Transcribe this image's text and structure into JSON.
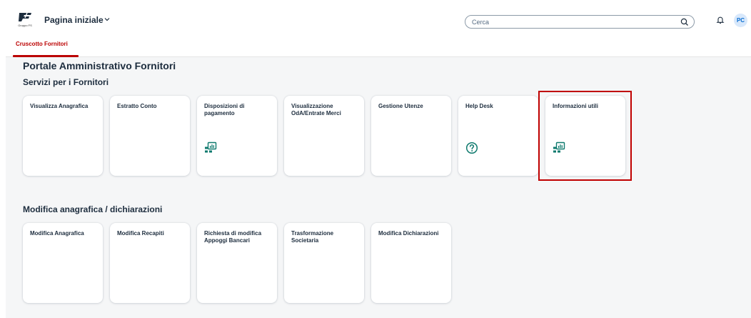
{
  "shell": {
    "logo_caption": "Gruppo FS",
    "app_title": "Pagina iniziale",
    "search_placeholder": "Cerca",
    "avatar_initials": "PC"
  },
  "tabs": [
    {
      "label": "Cruscotto Fornitori",
      "selected": true
    }
  ],
  "page": {
    "title": "Portale Amministrativo Fornitori"
  },
  "sections": [
    {
      "title": "Servizi per i Fornitori",
      "tiles": [
        {
          "label": "Visualizza Anagrafica",
          "icon": ""
        },
        {
          "label": "Estratto Conto",
          "icon": ""
        },
        {
          "label": "Disposizioni di pagamento",
          "icon": "chart-screen-icon"
        },
        {
          "label": "Visualizzazione OdA/Entrate Merci",
          "icon": ""
        },
        {
          "label": "Gestione Utenze",
          "icon": ""
        },
        {
          "label": "Help Desk",
          "icon": "help-circle-icon"
        },
        {
          "label": "Informazioni utili",
          "icon": "chart-screen-icon",
          "highlighted": true
        }
      ]
    },
    {
      "title": "Modifica anagrafica / dichiarazioni",
      "tiles": [
        {
          "label": "Modifica Anagrafica",
          "icon": ""
        },
        {
          "label": "Modifica Recapiti",
          "icon": ""
        },
        {
          "label": "Richiesta di modifica Appoggi Bancari",
          "icon": ""
        },
        {
          "label": "Trasformazione Societaria",
          "icon": ""
        },
        {
          "label": "Modifica Dichiarazioni",
          "icon": ""
        }
      ]
    }
  ],
  "colors": {
    "accent_red": "#bb0000",
    "highlight_red": "#c00000",
    "icon_teal": "#0f7a6e",
    "page_bg": "#f5f6f7"
  }
}
